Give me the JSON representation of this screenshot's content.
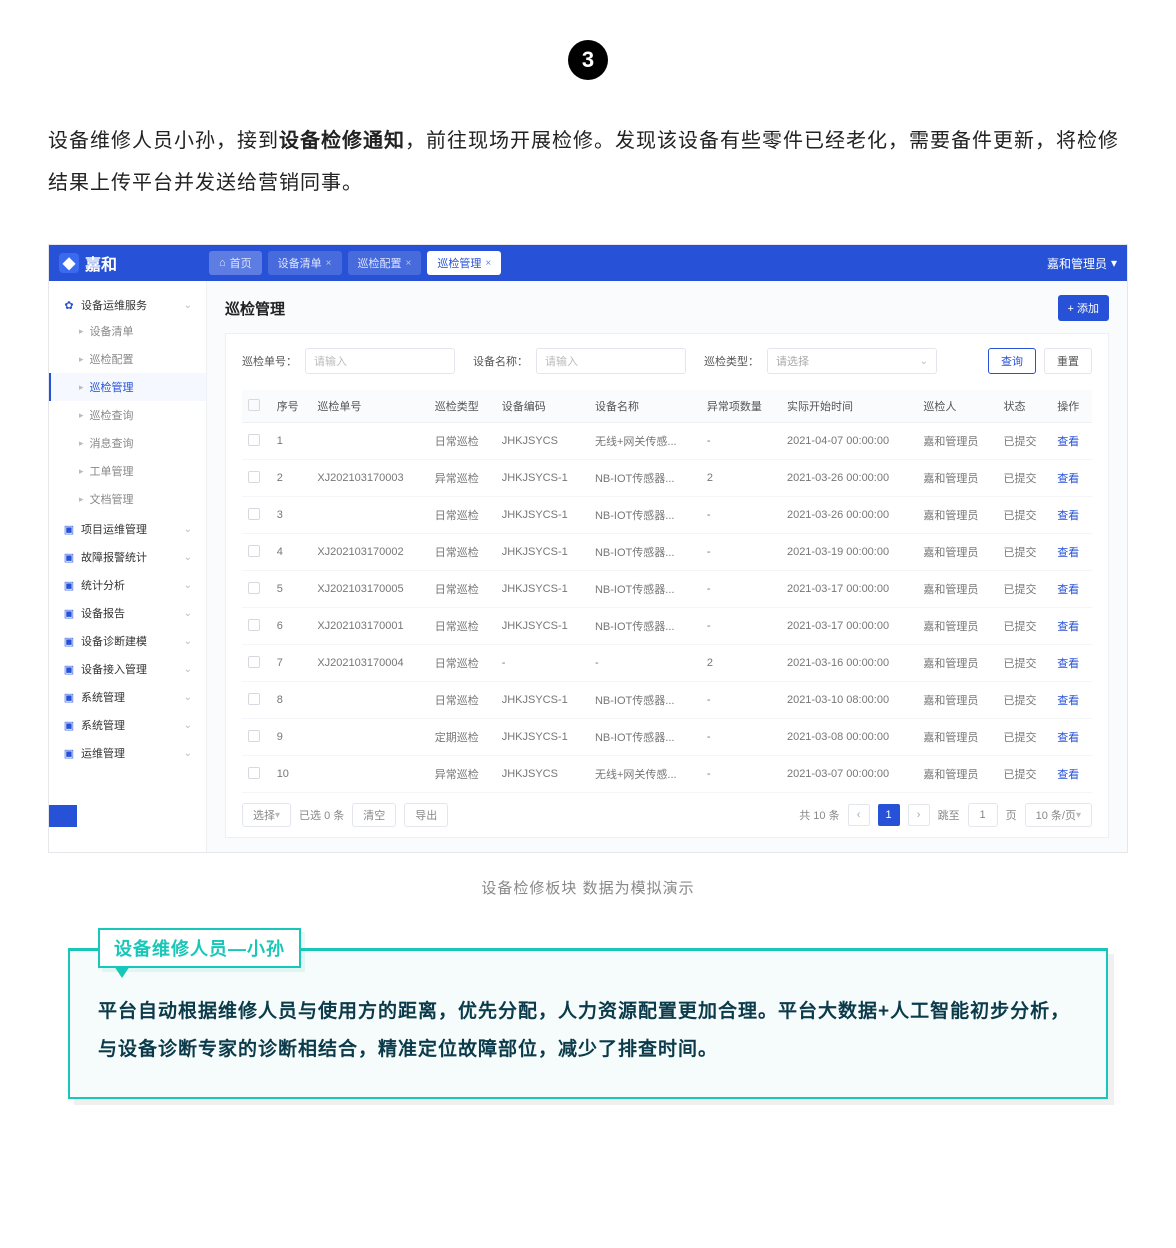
{
  "step_number": "3",
  "intro_before_bold": "设备维修人员小孙，接到",
  "intro_bold": "设备检修通知",
  "intro_after_bold": "，前往现场开展检修。发现该设备有些零件已经老化，需要备件更新，将检修结果上传平台并发送给营销同事。",
  "app": {
    "logo_text": "嘉和",
    "user_label": "嘉和管理员",
    "tabs": [
      {
        "label": "首页",
        "closable": false,
        "home": true
      },
      {
        "label": "设备清单",
        "closable": true
      },
      {
        "label": "巡检配置",
        "closable": true
      },
      {
        "label": "巡检管理",
        "closable": true,
        "active": true
      }
    ],
    "sidebar": {
      "group1": "设备运维服务",
      "items1": [
        "设备清单",
        "巡检配置",
        "巡检管理",
        "巡检查询",
        "消息查询",
        "工单管理",
        "文档管理"
      ],
      "active_item": "巡检管理",
      "groups_rest": [
        "项目运维管理",
        "故障报警统计",
        "统计分析",
        "设备报告",
        "设备诊断建模",
        "设备接入管理",
        "系统管理",
        "系统管理",
        "运维管理"
      ]
    },
    "main_title": "巡检管理",
    "add_btn": "+ 添加",
    "filters": {
      "f1_label": "巡检单号：",
      "f1_ph": "请输入",
      "f2_label": "设备名称：",
      "f2_ph": "请输入",
      "f3_label": "巡检类型：",
      "f3_ph": "请选择",
      "search": "查询",
      "reset": "重置"
    },
    "columns": [
      "",
      "序号",
      "巡检单号",
      "巡检类型",
      "设备编码",
      "设备名称",
      "异常项数量",
      "实际开始时间",
      "巡检人",
      "状态",
      "操作"
    ],
    "rows": [
      {
        "n": "1",
        "no": "",
        "type": "日常巡检",
        "code": "JHKJSYCS",
        "name": "无线+网关传感...",
        "abn": "-",
        "time": "2021-04-07 00:00:00",
        "who": "嘉和管理员",
        "st": "已提交",
        "op": "查看"
      },
      {
        "n": "2",
        "no": "XJ202103170003",
        "type": "异常巡检",
        "code": "JHKJSYCS-1",
        "name": "NB-IOT传感器...",
        "abn": "2",
        "time": "2021-03-26 00:00:00",
        "who": "嘉和管理员",
        "st": "已提交",
        "op": "查看"
      },
      {
        "n": "3",
        "no": "",
        "type": "日常巡检",
        "code": "JHKJSYCS-1",
        "name": "NB-IOT传感器...",
        "abn": "-",
        "time": "2021-03-26 00:00:00",
        "who": "嘉和管理员",
        "st": "已提交",
        "op": "查看"
      },
      {
        "n": "4",
        "no": "XJ202103170002",
        "type": "日常巡检",
        "code": "JHKJSYCS-1",
        "name": "NB-IOT传感器...",
        "abn": "-",
        "time": "2021-03-19 00:00:00",
        "who": "嘉和管理员",
        "st": "已提交",
        "op": "查看"
      },
      {
        "n": "5",
        "no": "XJ202103170005",
        "type": "日常巡检",
        "code": "JHKJSYCS-1",
        "name": "NB-IOT传感器...",
        "abn": "-",
        "time": "2021-03-17 00:00:00",
        "who": "嘉和管理员",
        "st": "已提交",
        "op": "查看"
      },
      {
        "n": "6",
        "no": "XJ202103170001",
        "type": "日常巡检",
        "code": "JHKJSYCS-1",
        "name": "NB-IOT传感器...",
        "abn": "-",
        "time": "2021-03-17 00:00:00",
        "who": "嘉和管理员",
        "st": "已提交",
        "op": "查看"
      },
      {
        "n": "7",
        "no": "XJ202103170004",
        "type": "日常巡检",
        "code": "-",
        "name": "-",
        "abn": "2",
        "time": "2021-03-16 00:00:00",
        "who": "嘉和管理员",
        "st": "已提交",
        "op": "查看"
      },
      {
        "n": "8",
        "no": "",
        "type": "日常巡检",
        "code": "JHKJSYCS-1",
        "name": "NB-IOT传感器...",
        "abn": "-",
        "time": "2021-03-10 08:00:00",
        "who": "嘉和管理员",
        "st": "已提交",
        "op": "查看"
      },
      {
        "n": "9",
        "no": "",
        "type": "定期巡检",
        "code": "JHKJSYCS-1",
        "name": "NB-IOT传感器...",
        "abn": "-",
        "time": "2021-03-08 00:00:00",
        "who": "嘉和管理员",
        "st": "已提交",
        "op": "查看"
      },
      {
        "n": "10",
        "no": "",
        "type": "异常巡检",
        "code": "JHKJSYCS",
        "name": "无线+网关传感...",
        "abn": "-",
        "time": "2021-03-07 00:00:00",
        "who": "嘉和管理员",
        "st": "已提交",
        "op": "查看"
      }
    ],
    "pager": {
      "select_label": "选择",
      "sel_count": "已选 0 条",
      "clear": "清空",
      "export": "导出",
      "total": "共 10 条",
      "page": "1",
      "jump_pre": "跳至",
      "jump_val": "1",
      "jump_post": "页",
      "size": "10 条/页"
    }
  },
  "caption": "设备检修板块 数据为模拟演示",
  "quote_title": "设备维修人员—小孙",
  "quote_body": "平台自动根据维修人员与使用方的距离，优先分配，人力资源配置更加合理。平台大数据+人工智能初步分析，与设备诊断专家的诊断相结合，精准定位故障部位，减少了排查时间。"
}
